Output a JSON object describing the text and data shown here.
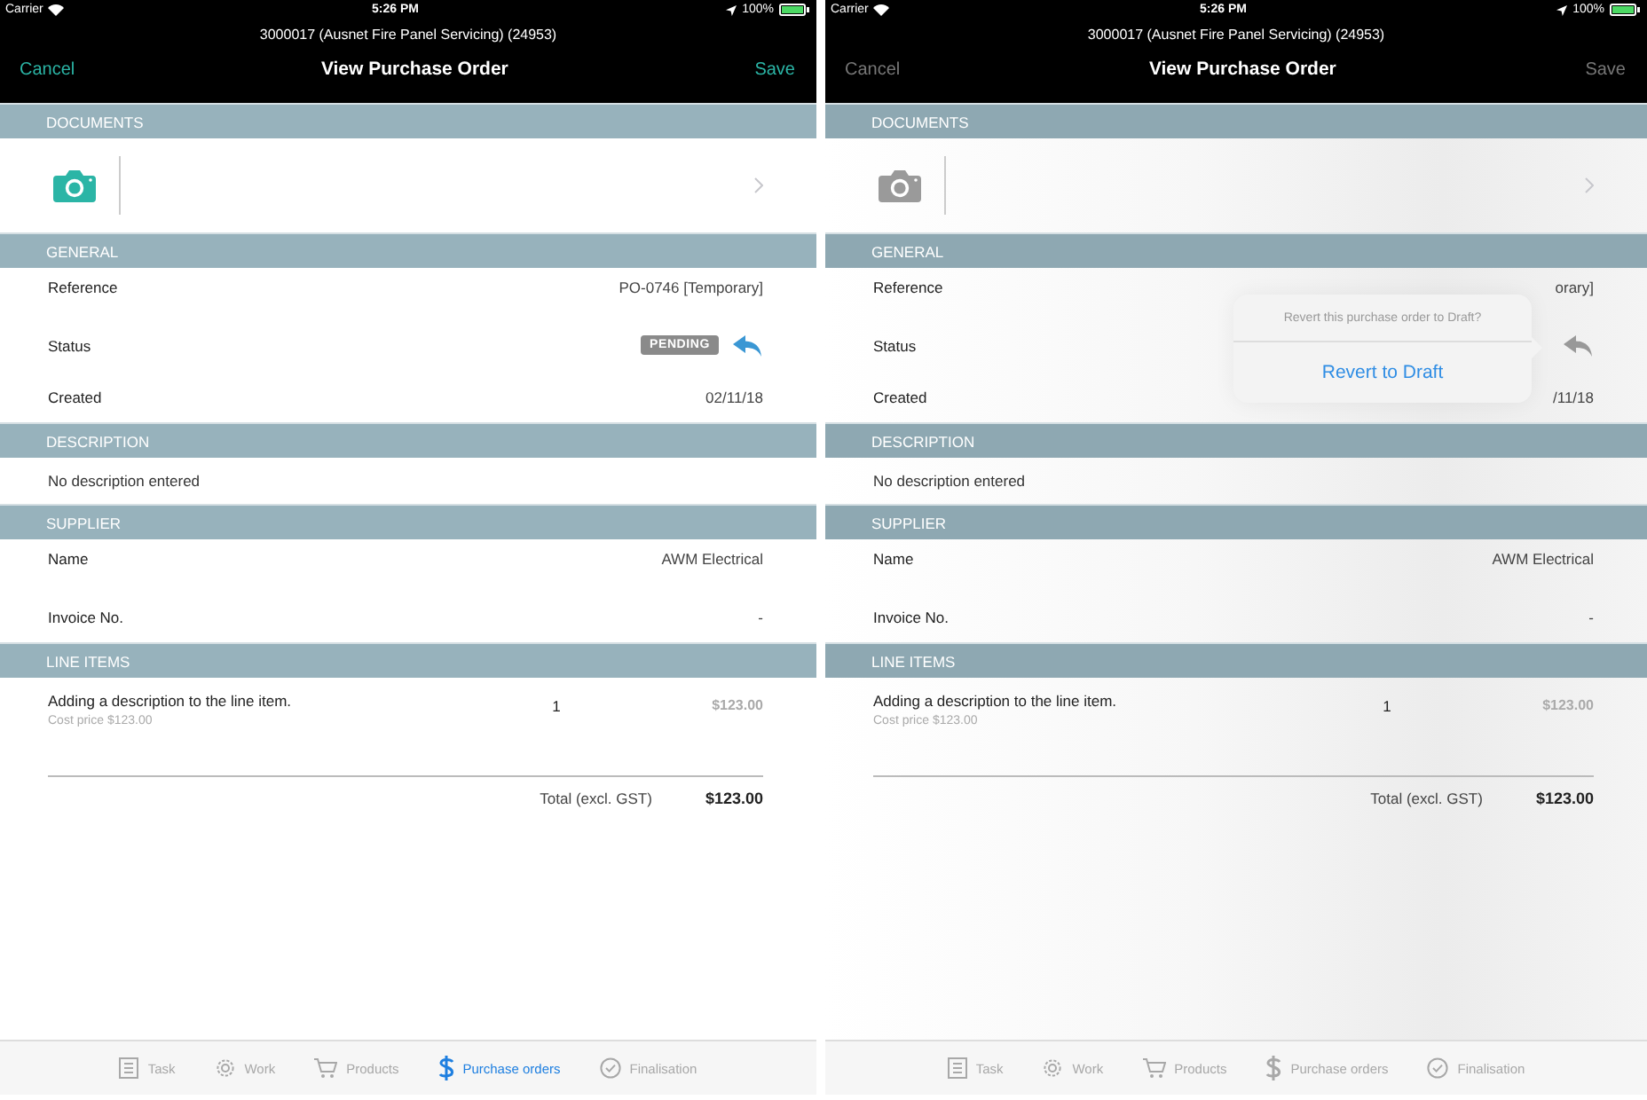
{
  "screens": [
    {
      "dimmed": false,
      "status_bar": {
        "carrier": "Carrier",
        "time": "5:26 PM",
        "battery": "100%"
      },
      "job_title": "3000017 (Ausnet Fire Panel Servicing) (24953)",
      "nav": {
        "cancel": "Cancel",
        "title": "View Purchase Order",
        "save": "Save"
      },
      "sections": [
        {
          "kind": "documents",
          "title": "DOCUMENTS"
        },
        {
          "kind": "fields",
          "title": "GENERAL",
          "rows": [
            {
              "kind": "text",
              "label": "Reference",
              "value": "PO-0746 [Temporary]"
            },
            {
              "kind": "status",
              "label": "Status",
              "badge": "PENDING"
            },
            {
              "kind": "text",
              "label": "Created",
              "value": "02/11/18"
            }
          ]
        },
        {
          "kind": "note",
          "title": "DESCRIPTION",
          "text": "No description entered"
        },
        {
          "kind": "fields",
          "title": "SUPPLIER",
          "rows": [
            {
              "kind": "text",
              "label": "Name",
              "value": "AWM Electrical"
            },
            {
              "kind": "text",
              "label": "Invoice No.",
              "value": "-"
            }
          ]
        },
        {
          "kind": "line_items",
          "title": "LINE ITEMS",
          "items": [
            {
              "description": "Adding a description to the line item.",
              "cost": "Cost price $123.00",
              "qty": "1",
              "amount": "$123.00"
            }
          ],
          "total_label": "Total (excl. GST)",
          "total": "$123.00"
        }
      ],
      "tabs": [
        {
          "label": "Task",
          "selected": false
        },
        {
          "label": "Work",
          "selected": false
        },
        {
          "label": "Products",
          "selected": false
        },
        {
          "label": "Purchase orders",
          "selected": true
        },
        {
          "label": "Finalisation",
          "selected": false
        }
      ]
    },
    {
      "dimmed": true,
      "status_bar": {
        "carrier": "Carrier",
        "time": "5:26 PM",
        "battery": "100%"
      },
      "job_title": "3000017 (Ausnet Fire Panel Servicing) (24953)",
      "nav": {
        "cancel": "Cancel",
        "title": "View Purchase Order",
        "save": "Save"
      },
      "sections": [
        {
          "kind": "documents",
          "title": "DOCUMENTS"
        },
        {
          "kind": "fields",
          "title": "GENERAL",
          "rows": [
            {
              "kind": "text",
              "label": "Reference",
              "value": "orary]"
            },
            {
              "kind": "status",
              "label": "Status"
            },
            {
              "kind": "text",
              "label": "Created",
              "value": "/11/18"
            }
          ]
        },
        {
          "kind": "note",
          "title": "DESCRIPTION",
          "text": "No description entered"
        },
        {
          "kind": "fields",
          "title": "SUPPLIER",
          "rows": [
            {
              "kind": "text",
              "label": "Name",
              "value": "AWM Electrical"
            },
            {
              "kind": "text",
              "label": "Invoice No.",
              "value": "-"
            }
          ]
        },
        {
          "kind": "line_items",
          "title": "LINE ITEMS",
          "items": [
            {
              "description": "Adding a description to the line item.",
              "cost": "Cost price $123.00",
              "qty": "1",
              "amount": "$123.00"
            }
          ],
          "total_label": "Total (excl. GST)",
          "total": "$123.00"
        }
      ],
      "tabs": [
        {
          "label": "Task"
        },
        {
          "label": "Work"
        },
        {
          "label": "Products"
        },
        {
          "label": "Purchase orders"
        },
        {
          "label": "Finalisation"
        }
      ],
      "popover": {
        "message": "Revert this purchase order to Draft?",
        "action": "Revert to Draft"
      }
    }
  ]
}
